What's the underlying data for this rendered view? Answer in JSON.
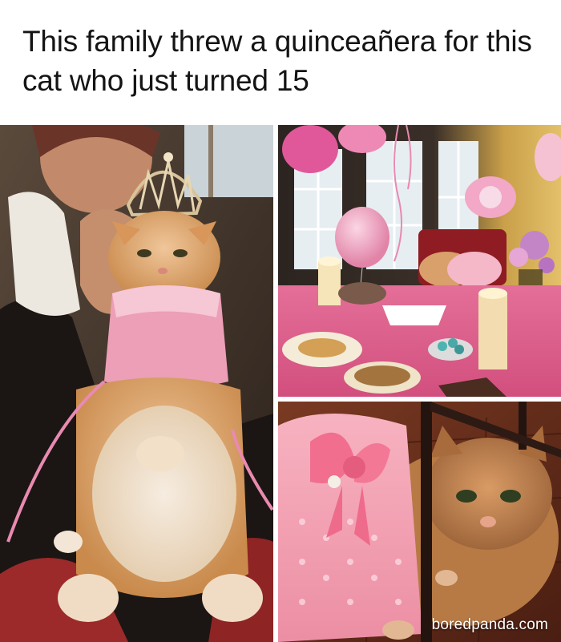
{
  "post": {
    "caption": "This family threw a quinceañera for this cat who just turned 15",
    "watermark": "boredpanda.com"
  },
  "photos": [
    {
      "slot": "left",
      "subject": "woman holding an orange tabby cat wearing a tiara and pink dress"
    },
    {
      "slot": "top-right",
      "subject": "party table with pink tablecloth, balloons, candles and food, cat in pink dress in background"
    },
    {
      "slot": "bottom-right",
      "subject": "close-up of orange tabby cat in pink dress with bow under a chair"
    }
  ],
  "colors": {
    "background": "#ffffff",
    "caption_text": "#141414",
    "accent_pink": "#e58aa6"
  }
}
